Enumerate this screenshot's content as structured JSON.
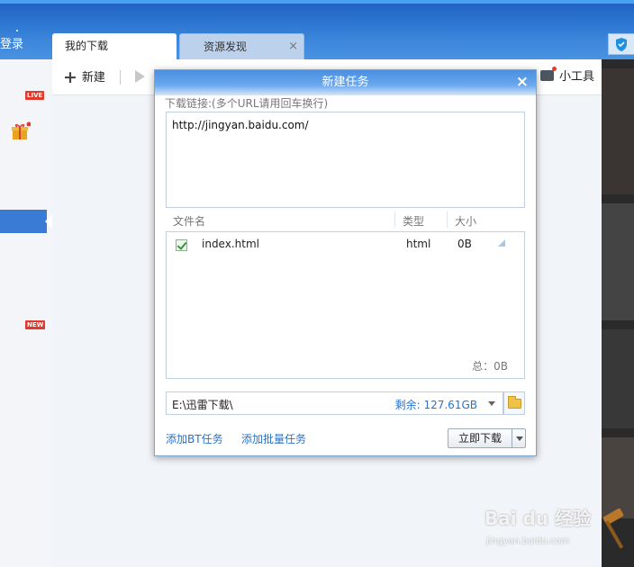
{
  "header": {
    "login_text": "登录",
    "tabs": [
      {
        "label": "我的下载",
        "active": true
      },
      {
        "label": "资源发现",
        "active": false
      }
    ],
    "tab_close_glyph": "×"
  },
  "sidebar": {
    "badges": [
      "LIVE",
      "NEW"
    ],
    "gift_icon": "gift-icon"
  },
  "toolbar": {
    "new_label": "新建",
    "tools_label": "小工具"
  },
  "dialog": {
    "title": "新建任务",
    "close_glyph": "×",
    "url_label": "下载链接:(多个URL请用回车换行)",
    "url_value": "http://jingyan.baidu.com/",
    "columns": {
      "name": "文件名",
      "type": "类型",
      "size": "大小"
    },
    "files": [
      {
        "checked": true,
        "name": "index.html",
        "type": "html",
        "size": "0B"
      }
    ],
    "total_label": "总：0B",
    "save_path": "E:\\迅雷下载\\",
    "free_space": "剩余: 127.61GB",
    "add_bt_label": "添加BT任务",
    "add_batch_label": "添加批量任务",
    "download_now_label": "立即下载"
  },
  "watermark": {
    "brand": "Bai du 经验",
    "url": "jingyan.baidu.com"
  },
  "colors": {
    "header_blue": "#2b74cf",
    "accent_link": "#2a72c8",
    "badge_red": "#e03a2f"
  }
}
